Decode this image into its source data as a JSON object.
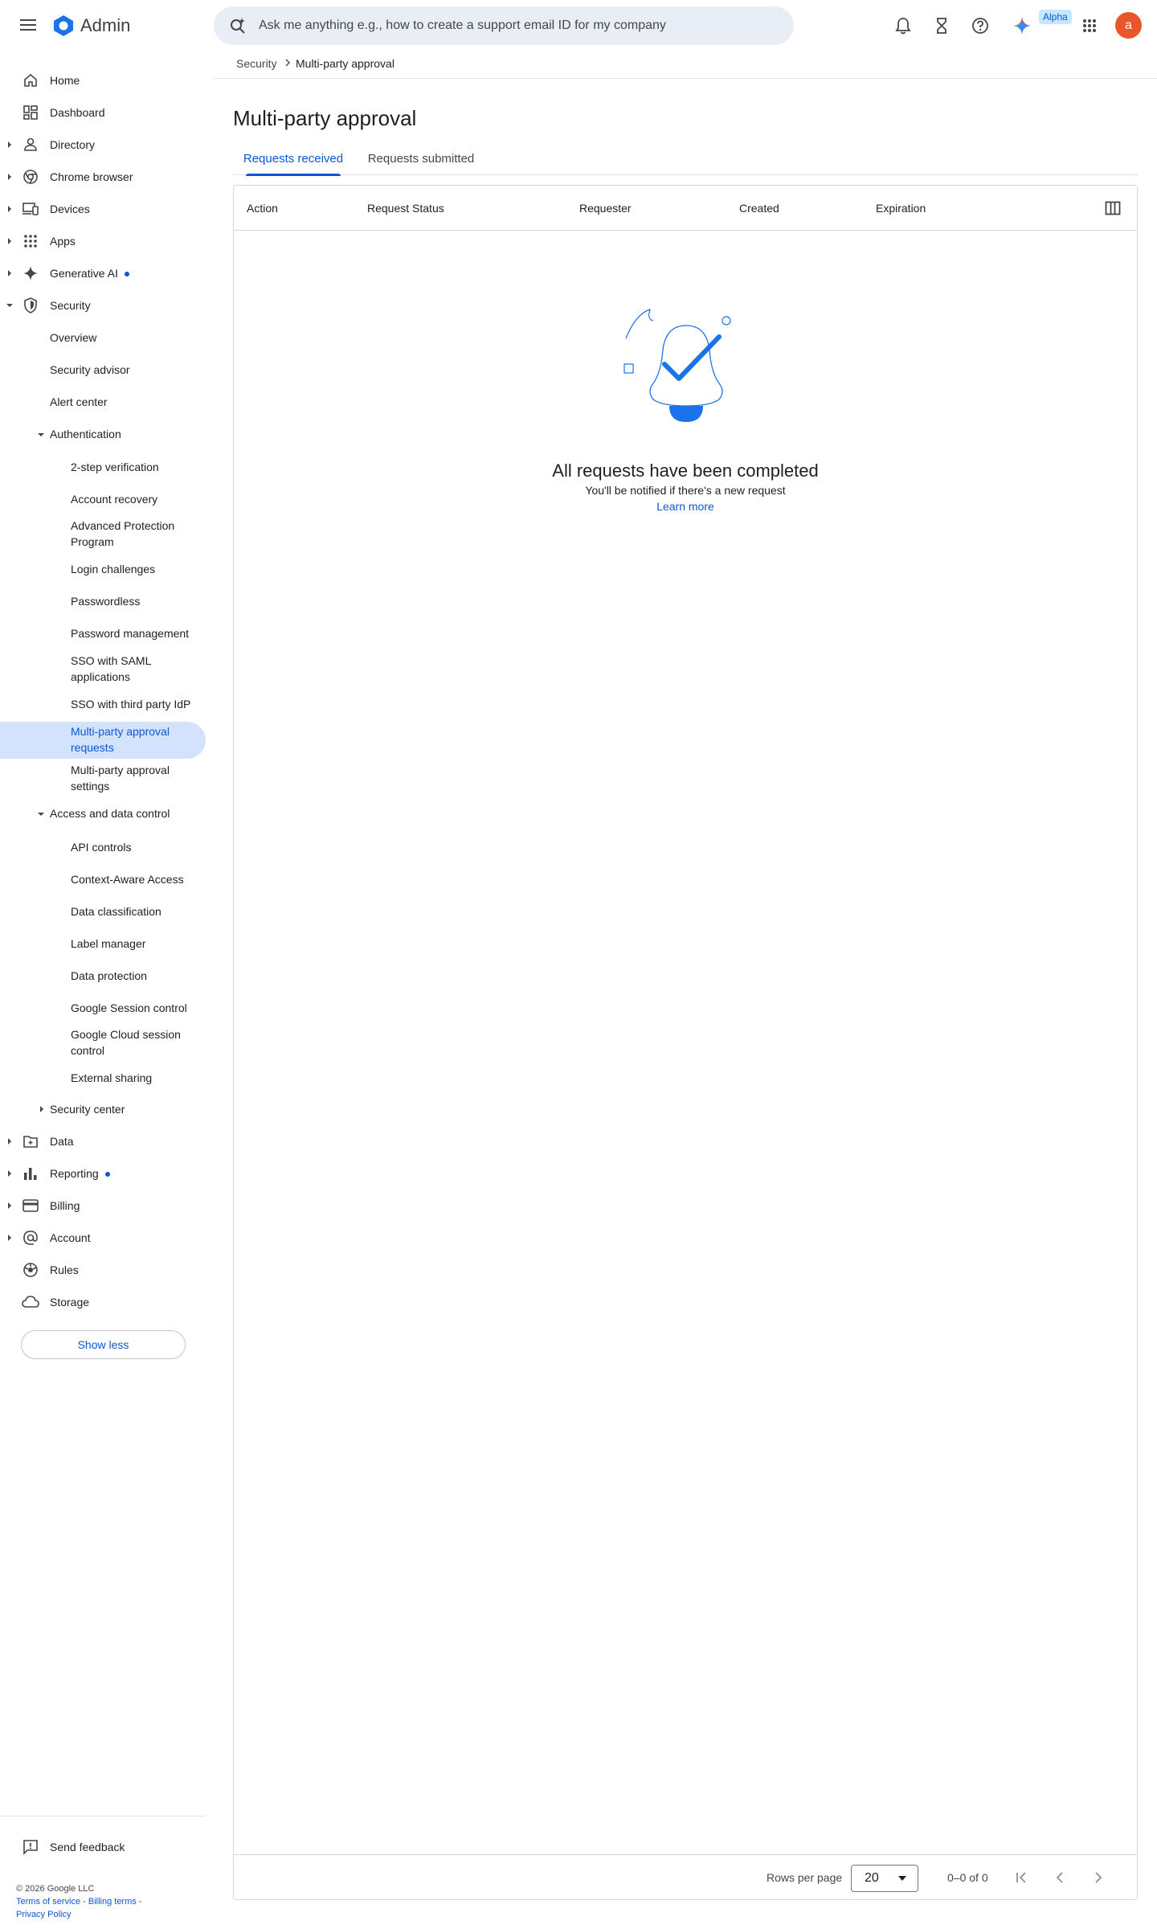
{
  "app": {
    "title": "Admin"
  },
  "search": {
    "placeholder": "Ask me anything e.g., how to create a support email ID for my company"
  },
  "topbar": {
    "alpha_badge": "Alpha",
    "avatar_letter": "a"
  },
  "breadcrumb": {
    "parent": "Security",
    "current": "Multi-party approval"
  },
  "sidebar": {
    "top_items": [
      {
        "label": "Home",
        "icon": "home-icon"
      },
      {
        "label": "Dashboard",
        "icon": "dashboard-icon"
      },
      {
        "label": "Directory",
        "icon": "person-icon"
      },
      {
        "label": "Chrome browser",
        "icon": "chrome-icon"
      },
      {
        "label": "Devices",
        "icon": "devices-icon"
      },
      {
        "label": "Apps",
        "icon": "apps-grid-icon"
      },
      {
        "label": "Generative AI",
        "icon": "sparkle-icon"
      },
      {
        "label": "Security",
        "icon": "shield-icon"
      }
    ],
    "security_children": {
      "overview": "Overview",
      "security_advisor": "Security advisor",
      "alert_center": "Alert center",
      "authentication": "Authentication",
      "auth_items": [
        "2-step verification",
        "Account recovery",
        "Advanced Protection Program",
        "Login challenges",
        "Passwordless",
        "Password management",
        "SSO with SAML applications",
        "SSO with third party IdP",
        "Multi-party approval requests",
        "Multi-party approval settings"
      ],
      "access_data_control": "Access and data control",
      "adc_items": [
        "API controls",
        "Context-Aware Access",
        "Data classification",
        "Label manager",
        "Data protection",
        "Google Session control",
        "Google Cloud session control",
        "External sharing"
      ],
      "security_center": "Security center"
    },
    "bottom_items": [
      {
        "label": "Data",
        "icon": "folder-icon"
      },
      {
        "label": "Reporting",
        "icon": "bar-chart-icon"
      },
      {
        "label": "Billing",
        "icon": "credit-card-icon"
      },
      {
        "label": "Account",
        "icon": "at-sign-icon"
      },
      {
        "label": "Rules",
        "icon": "rules-icon"
      },
      {
        "label": "Storage",
        "icon": "cloud-icon"
      }
    ],
    "show_less": "Show less",
    "send_feedback": "Send feedback"
  },
  "footer": {
    "copyright": "© 2026 Google LLC",
    "terms": "Terms of service",
    "billing_terms": "Billing terms",
    "privacy": "Privacy Policy"
  },
  "main": {
    "title": "Multi-party approval",
    "tabs": [
      {
        "label": "Requests received",
        "active": true
      },
      {
        "label": "Requests submitted",
        "active": false
      }
    ],
    "columns": [
      "Action",
      "Request Status",
      "Requester",
      "Created",
      "Expiration"
    ],
    "empty_state": {
      "title": "All requests have been completed",
      "subtitle": "You'll be notified if there's a new request",
      "link": "Learn more"
    },
    "pagination": {
      "rows_per_page_label": "Rows per page",
      "rows_per_page_value": "20",
      "range": "0–0 of 0"
    }
  },
  "colors": {
    "accent": "#0b57d0",
    "active_nav_bg": "#d3e3fd",
    "avatar": "#e8562a",
    "search_bg": "#e9eef6"
  }
}
